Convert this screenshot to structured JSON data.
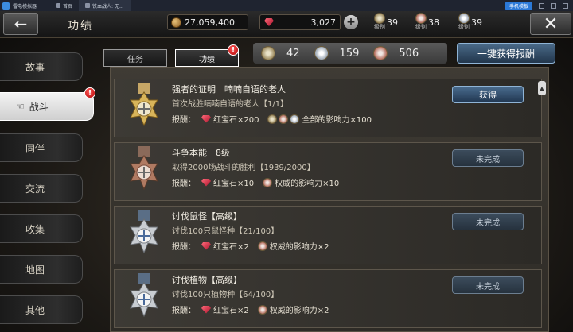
{
  "emulator": {
    "app_name": "雷电模拟器",
    "tabs": [
      {
        "label": "首页"
      },
      {
        "label": "铁血战人: 无..."
      }
    ],
    "right_button": "手机模板"
  },
  "header": {
    "title": "功绩",
    "gold": "27,059,400",
    "gems": "3,027",
    "ranks": [
      {
        "value": "39",
        "label": "级别"
      },
      {
        "value": "38",
        "label": "级别"
      },
      {
        "value": "39",
        "label": "级别"
      }
    ]
  },
  "sidebar": {
    "items": [
      {
        "label": "故事"
      },
      {
        "label": "战斗",
        "active": true,
        "alert": "!"
      },
      {
        "label": "同伴"
      },
      {
        "label": "交流"
      },
      {
        "label": "收集"
      },
      {
        "label": "地图"
      },
      {
        "label": "其他"
      }
    ]
  },
  "tabs": [
    {
      "label": "任务"
    },
    {
      "label": "功绩",
      "active": true,
      "alert": "!"
    }
  ],
  "summary": {
    "counts": [
      "42",
      "159",
      "506"
    ]
  },
  "claim_all_label": "一键获得报酬",
  "achievements": [
    {
      "title": "强者的证明　喃喃自语的老人",
      "desc": "首次战胜喃喃自语的老人【1/1】",
      "reward_label": "报酬：",
      "gem_reward": "红宝石×200",
      "extra_reward": "全部的影响力×100",
      "button": "获得",
      "status": "claimable",
      "medal_color": "gold"
    },
    {
      "title": "斗争本能　8级",
      "desc": "取得2000场战斗的胜利【1939/2000】",
      "reward_label": "报酬：",
      "gem_reward": "红宝石×10",
      "extra_reward": "权威的影响力×10",
      "button": "未完成",
      "status": "incomplete",
      "medal_color": "bronze"
    },
    {
      "title": "讨伐鼠怪【高级】",
      "desc": "讨伐100只鼠怪种【21/100】",
      "reward_label": "报酬：",
      "gem_reward": "红宝石×2",
      "extra_reward": "权威的影响力×2",
      "button": "未完成",
      "status": "incomplete",
      "medal_color": "silver"
    },
    {
      "title": "讨伐植物【高级】",
      "desc": "讨伐100只植物种【64/100】",
      "reward_label": "报酬：",
      "gem_reward": "红宝石×2",
      "extra_reward": "权威的影响力×2",
      "button": "未完成",
      "status": "incomplete",
      "medal_color": "silver"
    }
  ],
  "colors": {
    "accent_blue": "#4a6c8e",
    "alert_red": "#d00000",
    "gem_red": "#c8182e"
  }
}
